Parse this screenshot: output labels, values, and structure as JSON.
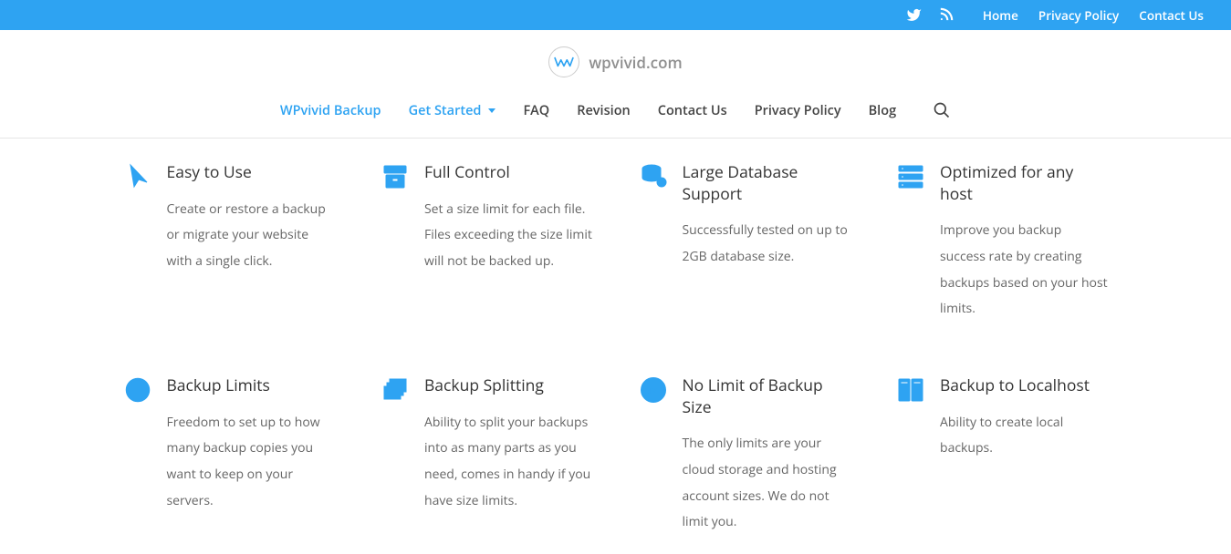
{
  "topbar": {
    "links": [
      "Home",
      "Privacy Policy",
      "Contact Us"
    ]
  },
  "brand": {
    "text": "wpvivid.com"
  },
  "nav": {
    "items": [
      {
        "label": "WPvivid Backup",
        "active": true,
        "dropdown": false
      },
      {
        "label": "Get Started",
        "active": true,
        "dropdown": true
      },
      {
        "label": "FAQ",
        "active": false,
        "dropdown": false
      },
      {
        "label": "Revision",
        "active": false,
        "dropdown": false
      },
      {
        "label": "Contact Us",
        "active": false,
        "dropdown": false
      },
      {
        "label": "Privacy Policy",
        "active": false,
        "dropdown": false
      },
      {
        "label": "Blog",
        "active": false,
        "dropdown": false
      }
    ]
  },
  "features": [
    {
      "icon": "pointer",
      "title": "Easy to Use",
      "desc": "Create or restore a backup or migrate your website with a single click."
    },
    {
      "icon": "archive",
      "title": "Full Control",
      "desc": "Set a size limit for each file. Files exceeding the size limit will not be backed up."
    },
    {
      "icon": "database",
      "title": "Large Database Support",
      "desc": "Successfully  tested on up to 2GB database size."
    },
    {
      "icon": "servers",
      "title": "Optimized for any host",
      "desc": "Improve you backup success rate by creating backups based on your host limits."
    },
    {
      "icon": "ban",
      "title": "Backup Limits",
      "desc": "Freedom to set up to how many backup copies you want to keep on your servers."
    },
    {
      "icon": "stack",
      "title": "Backup Splitting",
      "desc": "Ability to split your backups into as many parts as you need, comes in handy if you have size limits."
    },
    {
      "icon": "size",
      "title": "No Limit of Backup Size",
      "desc": "The only limits are your cloud storage and hosting account sizes. We do not limit you."
    },
    {
      "icon": "servers2",
      "title": "Backup to Localhost",
      "desc": "Ability to create local backups."
    }
  ]
}
